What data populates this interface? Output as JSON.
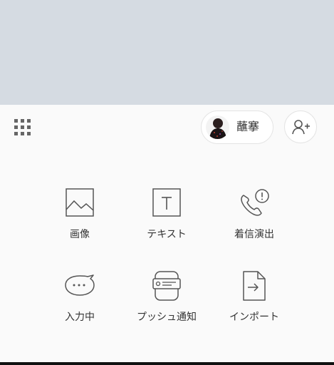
{
  "header": {
    "grid_icon": "grid-icon",
    "profile_name": "蘸搴",
    "add_friend_icon": "add-friend-icon"
  },
  "menu": {
    "items": [
      {
        "label": "画像",
        "icon": "image-icon"
      },
      {
        "label": "テキスト",
        "icon": "text-icon"
      },
      {
        "label": "着信演出",
        "icon": "phone-alert-icon"
      },
      {
        "label": "入力中",
        "icon": "typing-bubble-icon"
      },
      {
        "label": "プッシュ通知",
        "icon": "push-notification-icon"
      },
      {
        "label": "インポート",
        "icon": "import-icon"
      }
    ]
  },
  "colors": {
    "top_area": "#d5dbe2",
    "panel": "#fafafa",
    "icon": "#555555"
  }
}
